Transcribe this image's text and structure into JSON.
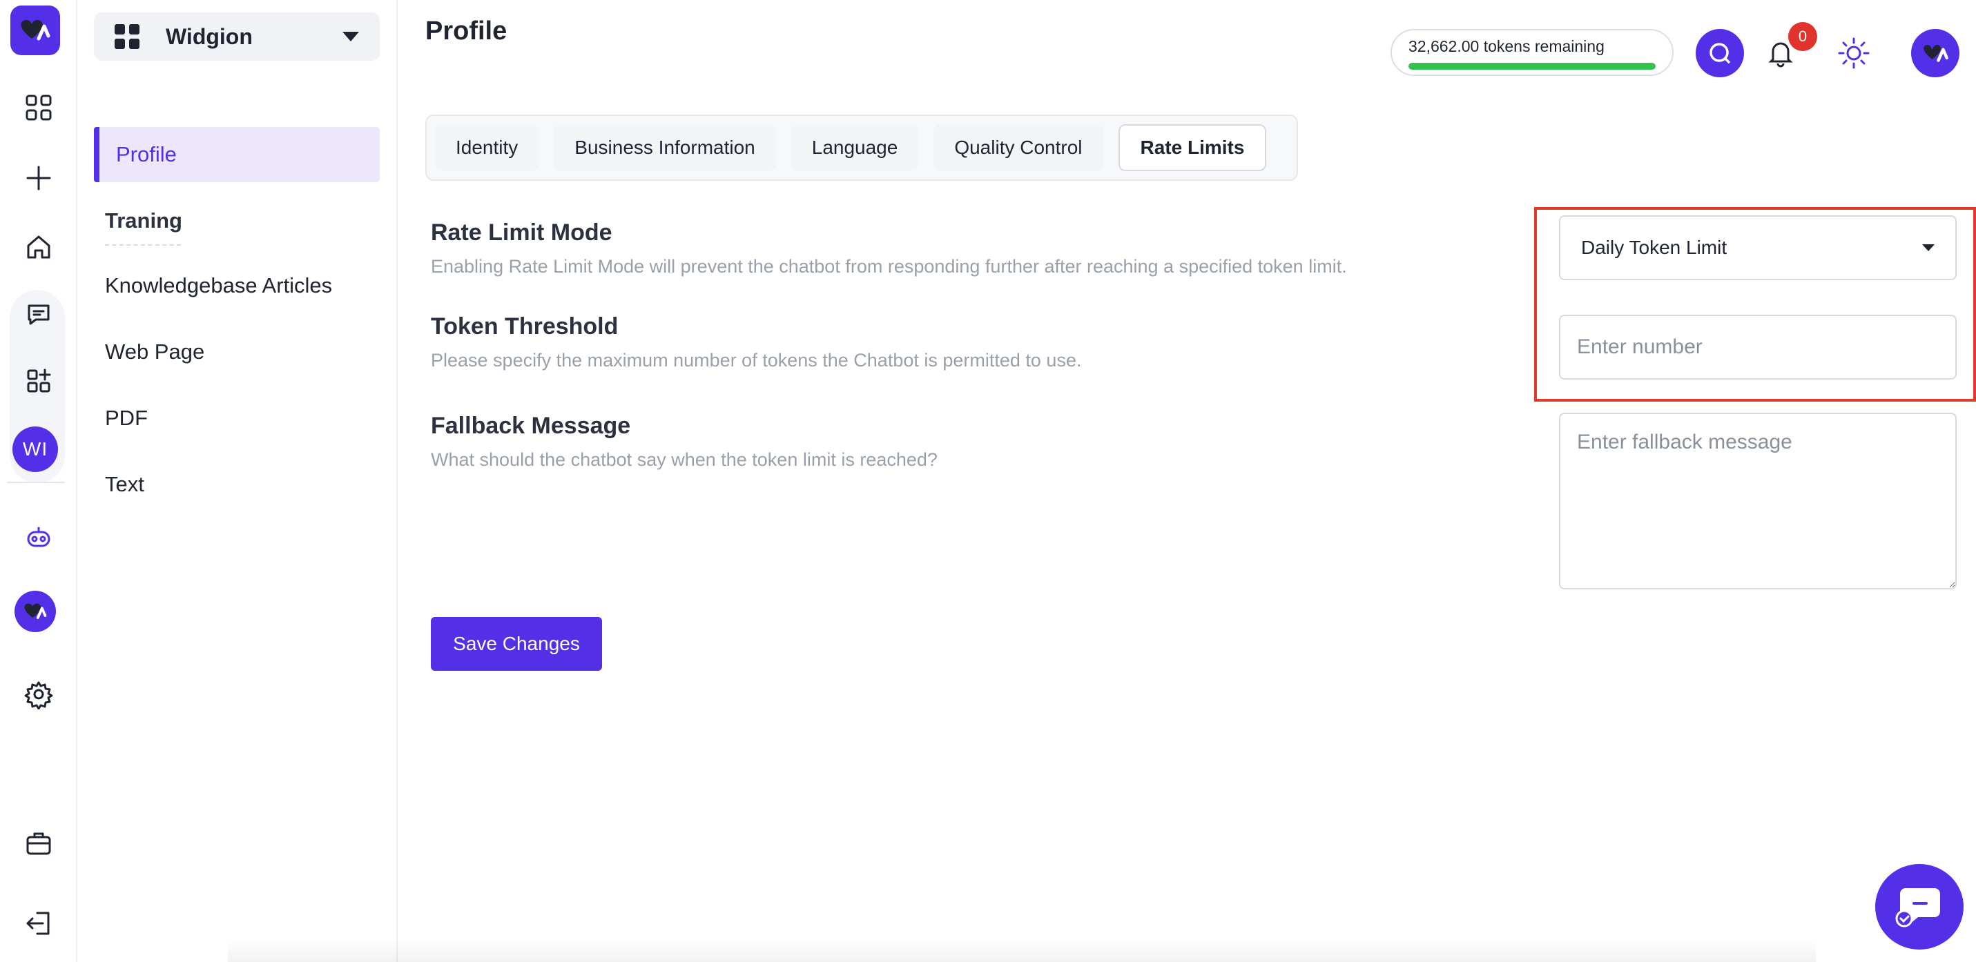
{
  "colors": {
    "brand": "#5330e8",
    "highlight": "#e03a2a",
    "token_bar": "#33c24d",
    "badge": "#e0332d"
  },
  "rail": {
    "items": [
      "logo-icon",
      "dashboard-icon",
      "plus-icon",
      "home-icon",
      "chat-icon",
      "apps-icon",
      "workspace-avatar",
      "bot-icon",
      "bot-avatar",
      "gear-icon",
      "briefcase-icon",
      "logout-icon"
    ],
    "workspace_initials": "WI"
  },
  "sidebar": {
    "workspace_name": "Widgion",
    "items": [
      {
        "label": "Profile"
      },
      {
        "label": "Traning"
      },
      {
        "label": "Knowledgebase Articles"
      },
      {
        "label": "Web Page"
      },
      {
        "label": "PDF"
      },
      {
        "label": "Text"
      }
    ]
  },
  "header": {
    "title": "Profile",
    "tokens_text": "32,662.00 tokens remaining",
    "tokens_fill_pct": 100,
    "notification_count": "0"
  },
  "tabs": [
    {
      "label": "Identity"
    },
    {
      "label": "Business Information"
    },
    {
      "label": "Language"
    },
    {
      "label": "Quality Control"
    },
    {
      "label": "Rate Limits"
    }
  ],
  "active_tab": "Rate Limits",
  "form": {
    "rate_limit": {
      "label": "Rate Limit Mode",
      "description": "Enabling Rate Limit Mode will prevent the chatbot from responding further after reaching a specified token limit.",
      "selected": "Daily Token Limit"
    },
    "threshold": {
      "label": "Token Threshold",
      "description": "Please specify the maximum number of tokens the Chatbot is permitted to use.",
      "placeholder": "Enter number"
    },
    "fallback": {
      "label": "Fallback Message",
      "description": "What should the chatbot say when the token limit is reached?",
      "placeholder": "Enter fallback message"
    },
    "save_label": "Save Changes"
  }
}
